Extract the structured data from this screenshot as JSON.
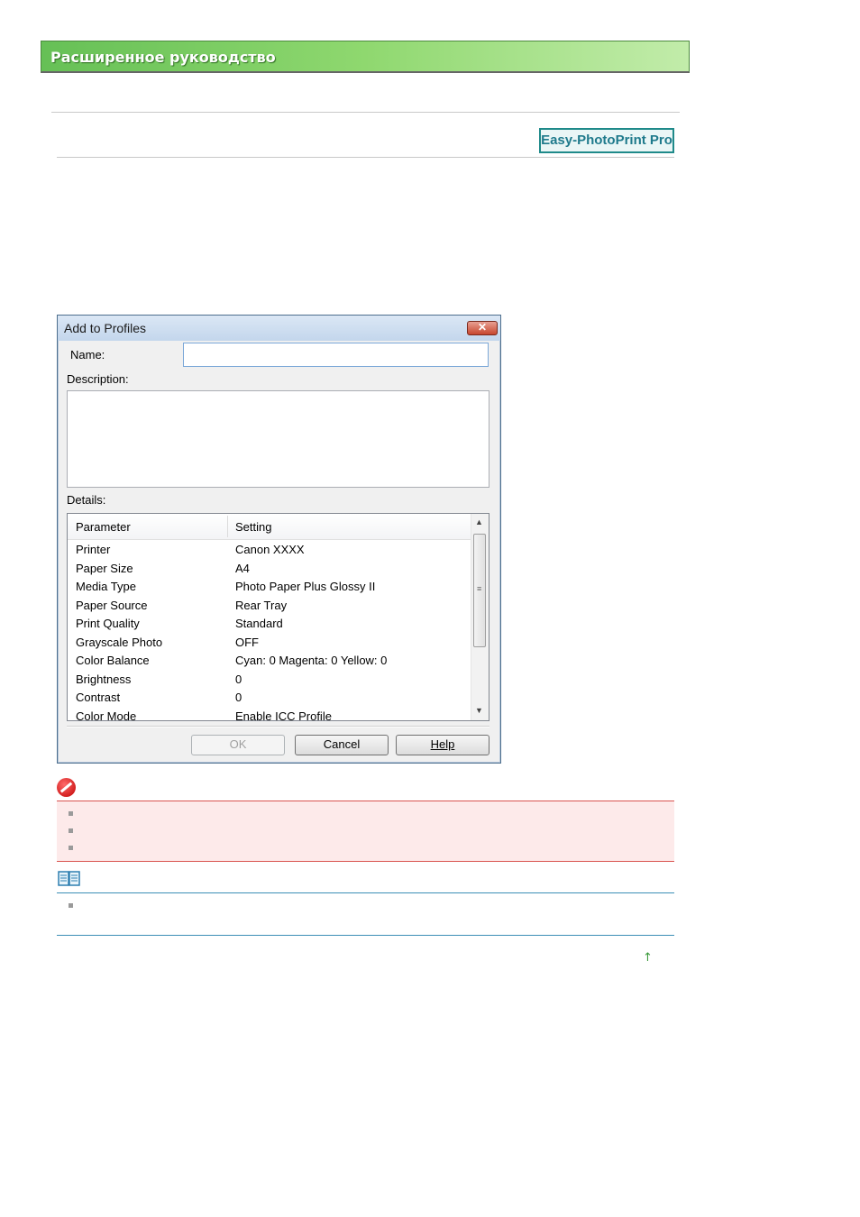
{
  "header": {
    "title": "Расширенное руководство"
  },
  "app_badge": {
    "label": "Easy-PhotoPrint Pro"
  },
  "dialog": {
    "title": "Add to Profiles",
    "close_glyph": "✕",
    "name_label": "Name:",
    "name_value": "",
    "description_label": "Description:",
    "description_value": "",
    "details_label": "Details:",
    "columns": {
      "parameter": "Parameter",
      "setting": "Setting"
    },
    "rows": [
      {
        "parameter": "Printer",
        "setting": "Canon XXXX"
      },
      {
        "parameter": "Paper Size",
        "setting": "A4"
      },
      {
        "parameter": "Media Type",
        "setting": "Photo Paper Plus Glossy II"
      },
      {
        "parameter": "Paper Source",
        "setting": "Rear Tray"
      },
      {
        "parameter": "Print Quality",
        "setting": "Standard"
      },
      {
        "parameter": "Grayscale Photo",
        "setting": "OFF"
      },
      {
        "parameter": "Color Balance",
        "setting": "Cyan: 0  Magenta: 0  Yellow: 0"
      },
      {
        "parameter": "Brightness",
        "setting": "0"
      },
      {
        "parameter": "Contrast",
        "setting": "0"
      },
      {
        "parameter": "Color Mode",
        "setting": "Enable ICC Profile"
      }
    ],
    "buttons": {
      "ok": "OK",
      "cancel": "Cancel",
      "help": "Help"
    }
  },
  "top_link": {
    "glyph": "↑"
  },
  "colors": {
    "header_green": "#66c056",
    "caution_red": "#d9534f",
    "note_blue": "#3c8fb6"
  }
}
